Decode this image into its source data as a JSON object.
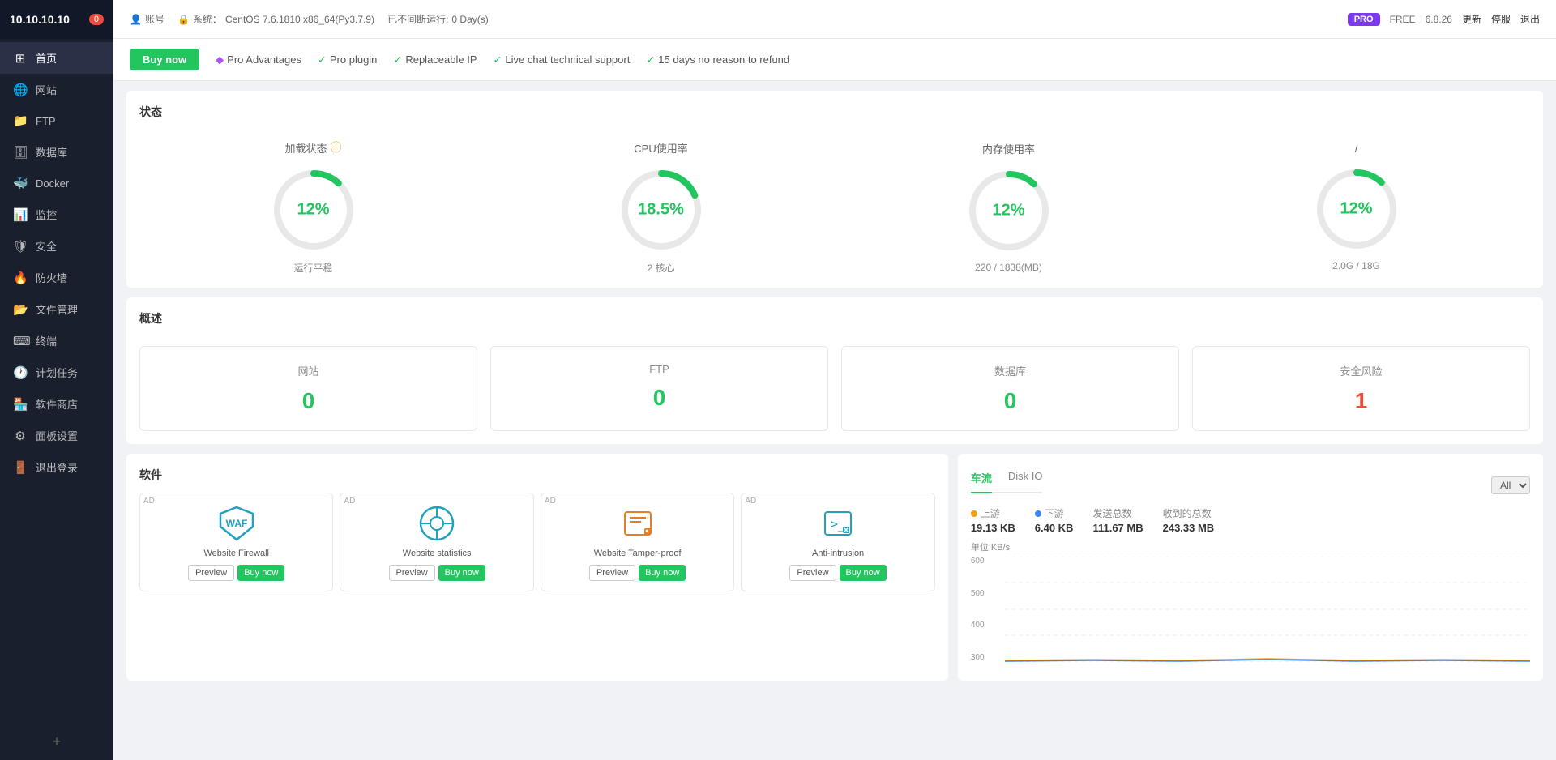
{
  "sidebar": {
    "ip": "10.10.10.10",
    "badge": "0",
    "items": [
      {
        "id": "home",
        "label": "首页",
        "icon": "⊞",
        "active": true
      },
      {
        "id": "website",
        "label": "网站",
        "icon": "🌐",
        "active": false
      },
      {
        "id": "ftp",
        "label": "FTP",
        "icon": "📁",
        "active": false
      },
      {
        "id": "database",
        "label": "数据库",
        "icon": "🗄",
        "active": false
      },
      {
        "id": "docker",
        "label": "Docker",
        "icon": "🐳",
        "active": false
      },
      {
        "id": "monitor",
        "label": "监控",
        "icon": "📊",
        "active": false
      },
      {
        "id": "security",
        "label": "安全",
        "icon": "🛡",
        "active": false
      },
      {
        "id": "firewall",
        "label": "防火墙",
        "icon": "🔥",
        "active": false
      },
      {
        "id": "filemanager",
        "label": "文件管理",
        "icon": "📂",
        "active": false
      },
      {
        "id": "terminal",
        "label": "终端",
        "icon": "⌨",
        "active": false
      },
      {
        "id": "crontab",
        "label": "计划任务",
        "icon": "🕐",
        "active": false
      },
      {
        "id": "appstore",
        "label": "软件商店",
        "icon": "🏪",
        "active": false
      },
      {
        "id": "panelsettings",
        "label": "面板设置",
        "icon": "⚙",
        "active": false
      },
      {
        "id": "logout",
        "label": "退出登录",
        "icon": "🚪",
        "active": false
      }
    ]
  },
  "topbar": {
    "account_label": "账号",
    "system_label": "系统：",
    "system_value": "CentOS 7.6.1810 x86_64(Py3.7.9)",
    "uptime_label": "已不间断运行:",
    "uptime_value": "0 Day(s)",
    "pro_badge": "PRO",
    "free_label": "FREE",
    "version": "6.8.26",
    "update_label": "更新",
    "stop_label": "停服",
    "exit_label": "退出"
  },
  "pro_banner": {
    "buy_now": "Buy now",
    "pro_advantages": "Pro Advantages",
    "features": [
      {
        "label": "Pro plugin"
      },
      {
        "label": "Replaceable IP"
      },
      {
        "label": "Live chat technical support"
      },
      {
        "label": "15 days no reason to refund"
      }
    ]
  },
  "status": {
    "title": "状态",
    "gauges": [
      {
        "label": "加载状态",
        "has_info": true,
        "value": "12%",
        "percent": 12,
        "sublabel": "运行平稳",
        "color": "#22c55e"
      },
      {
        "label": "CPU使用率",
        "has_info": false,
        "value": "18.5%",
        "percent": 18.5,
        "sublabel": "2 核心",
        "color": "#22c55e"
      },
      {
        "label": "内存使用率",
        "has_info": false,
        "value": "12%",
        "percent": 12,
        "sublabel": "220 / 1838(MB)",
        "color": "#22c55e"
      },
      {
        "label": "/",
        "has_info": false,
        "value": "12%",
        "percent": 12,
        "sublabel": "2.0G / 18G",
        "color": "#22c55e"
      }
    ]
  },
  "overview": {
    "title": "概述",
    "cards": [
      {
        "label": "网站",
        "value": "0",
        "danger": false
      },
      {
        "label": "FTP",
        "value": "0",
        "danger": false
      },
      {
        "label": "数据库",
        "value": "0",
        "danger": false
      },
      {
        "label": "安全风险",
        "value": "1",
        "danger": true
      }
    ]
  },
  "software": {
    "title": "软件",
    "items": [
      {
        "ad": "AD",
        "name": "Website Firewall",
        "icon_type": "waf",
        "preview_label": "Preview",
        "buy_label": "Buy now"
      },
      {
        "ad": "AD",
        "name": "Website statistics",
        "icon_type": "stats",
        "preview_label": "Preview",
        "buy_label": "Buy now"
      },
      {
        "ad": "AD",
        "name": "Website Tamper-proof",
        "icon_type": "tamper",
        "preview_label": "Preview",
        "buy_label": "Buy now"
      },
      {
        "ad": "AD",
        "name": "Anti-intrusion",
        "icon_type": "anti",
        "preview_label": "Preview",
        "buy_label": "Buy now"
      }
    ]
  },
  "network": {
    "tabs": [
      "车流",
      "Disk IO"
    ],
    "active_tab": 0,
    "filter_label": "All",
    "stats": [
      {
        "dot_color": "#f59e0b",
        "label": "上游",
        "value": "19.13 KB"
      },
      {
        "dot_color": "#3b82f6",
        "label": "下游",
        "value": "6.40 KB"
      },
      {
        "label": "发送总数",
        "value": "111.67 MB"
      },
      {
        "label": "收到的总数",
        "value": "243.33 MB"
      }
    ],
    "unit_label": "单位:KB/s",
    "y_labels": [
      "600",
      "500",
      "400",
      "300"
    ]
  }
}
